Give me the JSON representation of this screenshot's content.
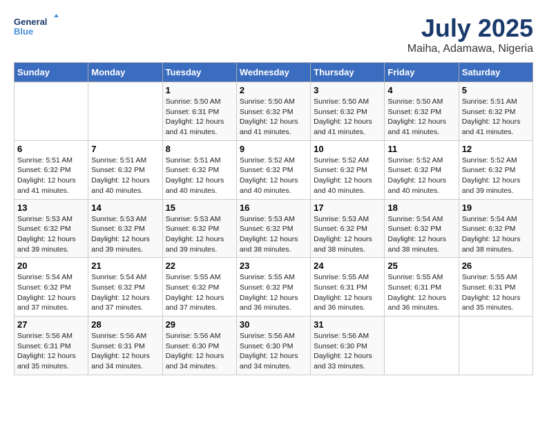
{
  "logo": {
    "line1": "General",
    "line2": "Blue"
  },
  "title": {
    "month_year": "July 2025",
    "location": "Maiha, Adamawa, Nigeria"
  },
  "headers": [
    "Sunday",
    "Monday",
    "Tuesday",
    "Wednesday",
    "Thursday",
    "Friday",
    "Saturday"
  ],
  "weeks": [
    [
      {
        "day": "",
        "info": ""
      },
      {
        "day": "",
        "info": ""
      },
      {
        "day": "1",
        "info": "Sunrise: 5:50 AM\nSunset: 6:31 PM\nDaylight: 12 hours and 41 minutes."
      },
      {
        "day": "2",
        "info": "Sunrise: 5:50 AM\nSunset: 6:32 PM\nDaylight: 12 hours and 41 minutes."
      },
      {
        "day": "3",
        "info": "Sunrise: 5:50 AM\nSunset: 6:32 PM\nDaylight: 12 hours and 41 minutes."
      },
      {
        "day": "4",
        "info": "Sunrise: 5:50 AM\nSunset: 6:32 PM\nDaylight: 12 hours and 41 minutes."
      },
      {
        "day": "5",
        "info": "Sunrise: 5:51 AM\nSunset: 6:32 PM\nDaylight: 12 hours and 41 minutes."
      }
    ],
    [
      {
        "day": "6",
        "info": "Sunrise: 5:51 AM\nSunset: 6:32 PM\nDaylight: 12 hours and 41 minutes."
      },
      {
        "day": "7",
        "info": "Sunrise: 5:51 AM\nSunset: 6:32 PM\nDaylight: 12 hours and 40 minutes."
      },
      {
        "day": "8",
        "info": "Sunrise: 5:51 AM\nSunset: 6:32 PM\nDaylight: 12 hours and 40 minutes."
      },
      {
        "day": "9",
        "info": "Sunrise: 5:52 AM\nSunset: 6:32 PM\nDaylight: 12 hours and 40 minutes."
      },
      {
        "day": "10",
        "info": "Sunrise: 5:52 AM\nSunset: 6:32 PM\nDaylight: 12 hours and 40 minutes."
      },
      {
        "day": "11",
        "info": "Sunrise: 5:52 AM\nSunset: 6:32 PM\nDaylight: 12 hours and 40 minutes."
      },
      {
        "day": "12",
        "info": "Sunrise: 5:52 AM\nSunset: 6:32 PM\nDaylight: 12 hours and 39 minutes."
      }
    ],
    [
      {
        "day": "13",
        "info": "Sunrise: 5:53 AM\nSunset: 6:32 PM\nDaylight: 12 hours and 39 minutes."
      },
      {
        "day": "14",
        "info": "Sunrise: 5:53 AM\nSunset: 6:32 PM\nDaylight: 12 hours and 39 minutes."
      },
      {
        "day": "15",
        "info": "Sunrise: 5:53 AM\nSunset: 6:32 PM\nDaylight: 12 hours and 39 minutes."
      },
      {
        "day": "16",
        "info": "Sunrise: 5:53 AM\nSunset: 6:32 PM\nDaylight: 12 hours and 38 minutes."
      },
      {
        "day": "17",
        "info": "Sunrise: 5:53 AM\nSunset: 6:32 PM\nDaylight: 12 hours and 38 minutes."
      },
      {
        "day": "18",
        "info": "Sunrise: 5:54 AM\nSunset: 6:32 PM\nDaylight: 12 hours and 38 minutes."
      },
      {
        "day": "19",
        "info": "Sunrise: 5:54 AM\nSunset: 6:32 PM\nDaylight: 12 hours and 38 minutes."
      }
    ],
    [
      {
        "day": "20",
        "info": "Sunrise: 5:54 AM\nSunset: 6:32 PM\nDaylight: 12 hours and 37 minutes."
      },
      {
        "day": "21",
        "info": "Sunrise: 5:54 AM\nSunset: 6:32 PM\nDaylight: 12 hours and 37 minutes."
      },
      {
        "day": "22",
        "info": "Sunrise: 5:55 AM\nSunset: 6:32 PM\nDaylight: 12 hours and 37 minutes."
      },
      {
        "day": "23",
        "info": "Sunrise: 5:55 AM\nSunset: 6:32 PM\nDaylight: 12 hours and 36 minutes."
      },
      {
        "day": "24",
        "info": "Sunrise: 5:55 AM\nSunset: 6:31 PM\nDaylight: 12 hours and 36 minutes."
      },
      {
        "day": "25",
        "info": "Sunrise: 5:55 AM\nSunset: 6:31 PM\nDaylight: 12 hours and 36 minutes."
      },
      {
        "day": "26",
        "info": "Sunrise: 5:55 AM\nSunset: 6:31 PM\nDaylight: 12 hours and 35 minutes."
      }
    ],
    [
      {
        "day": "27",
        "info": "Sunrise: 5:56 AM\nSunset: 6:31 PM\nDaylight: 12 hours and 35 minutes."
      },
      {
        "day": "28",
        "info": "Sunrise: 5:56 AM\nSunset: 6:31 PM\nDaylight: 12 hours and 34 minutes."
      },
      {
        "day": "29",
        "info": "Sunrise: 5:56 AM\nSunset: 6:30 PM\nDaylight: 12 hours and 34 minutes."
      },
      {
        "day": "30",
        "info": "Sunrise: 5:56 AM\nSunset: 6:30 PM\nDaylight: 12 hours and 34 minutes."
      },
      {
        "day": "31",
        "info": "Sunrise: 5:56 AM\nSunset: 6:30 PM\nDaylight: 12 hours and 33 minutes."
      },
      {
        "day": "",
        "info": ""
      },
      {
        "day": "",
        "info": ""
      }
    ]
  ]
}
